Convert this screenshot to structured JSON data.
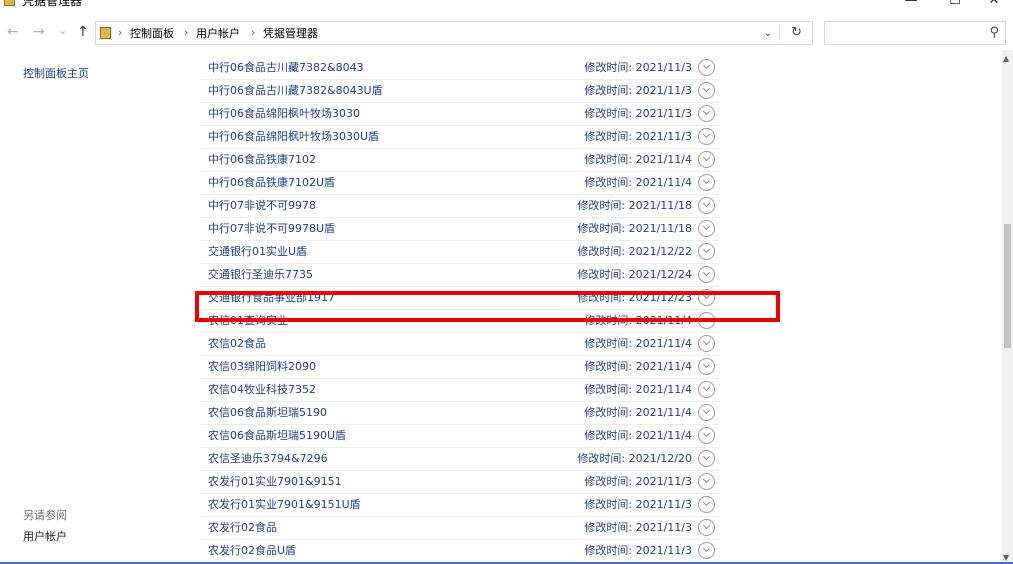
{
  "window": {
    "title": "凭据管理器",
    "minimize_glyph": "—",
    "maximize_glyph": "☐",
    "close_glyph": "✕"
  },
  "nav": {
    "back_glyph": "←",
    "forward_glyph": "→",
    "recent_glyph": "⌄",
    "up_glyph": "↑",
    "breadcrumb": [
      "控制面板",
      "用户帐户",
      "凭据管理器"
    ],
    "separator": "›",
    "dropdown_glyph": "⌄",
    "refresh_glyph": "↻"
  },
  "search": {
    "placeholder": "",
    "icon_glyph": "⚲"
  },
  "sidebar": {
    "home_link": "控制面板主页",
    "see_also_label": "另请参阅",
    "see_also_link": "用户帐户"
  },
  "credentials": [
    {
      "name": "中行06食品古川藏7382&8043",
      "time": "修改时间: 2021/11/3"
    },
    {
      "name": "中行06食品古川藏7382&8043U盾",
      "time": "修改时间: 2021/11/3"
    },
    {
      "name": "中行06食品绵阳枫叶牧场3030",
      "time": "修改时间: 2021/11/3"
    },
    {
      "name": "中行06食品绵阳枫叶牧场3030U盾",
      "time": "修改时间: 2021/11/3"
    },
    {
      "name": "中行06食品铁康7102",
      "time": "修改时间: 2021/11/4"
    },
    {
      "name": "中行06食品铁康7102U盾",
      "time": "修改时间: 2021/11/4"
    },
    {
      "name": "中行07非说不可9978",
      "time": "修改时间: 2021/11/18"
    },
    {
      "name": "中行07非说不可9978U盾",
      "time": "修改时间: 2021/11/18"
    },
    {
      "name": "交通银行01实业U盾",
      "time": "修改时间: 2021/12/22"
    },
    {
      "name": "交通银行圣迪乐7735",
      "time": "修改时间: 2021/12/24"
    },
    {
      "name": "交通银行食品事业部1917",
      "time": "修改时间: 2021/12/23"
    },
    {
      "name": "农信01查询实业",
      "time": "修改时间: 2021/11/4"
    },
    {
      "name": "农信02食品",
      "time": "修改时间: 2021/11/4"
    },
    {
      "name": "农信03绵阳饲料2090",
      "time": "修改时间: 2021/11/4"
    },
    {
      "name": "农信04牧业科技7352",
      "time": "修改时间: 2021/11/4"
    },
    {
      "name": "农信06食品斯坦瑞5190",
      "time": "修改时间: 2021/11/4"
    },
    {
      "name": "农信06食品斯坦瑞5190U盾",
      "time": "修改时间: 2021/11/4"
    },
    {
      "name": "农信圣迪乐3794&7296",
      "time": "修改时间: 2021/12/20"
    },
    {
      "name": "农发行01实业7901&9151",
      "time": "修改时间: 2021/11/3"
    },
    {
      "name": "农发行01实业7901&9151U盾",
      "time": "修改时间: 2021/11/3"
    },
    {
      "name": "农发行02食品",
      "time": "修改时间: 2021/11/3"
    },
    {
      "name": "农发行02食品U盾",
      "time": "修改时间: 2021/11/3"
    }
  ],
  "highlighted_index": 10,
  "scrollbar": {
    "up_glyph": "▲",
    "down_glyph": "▼"
  }
}
